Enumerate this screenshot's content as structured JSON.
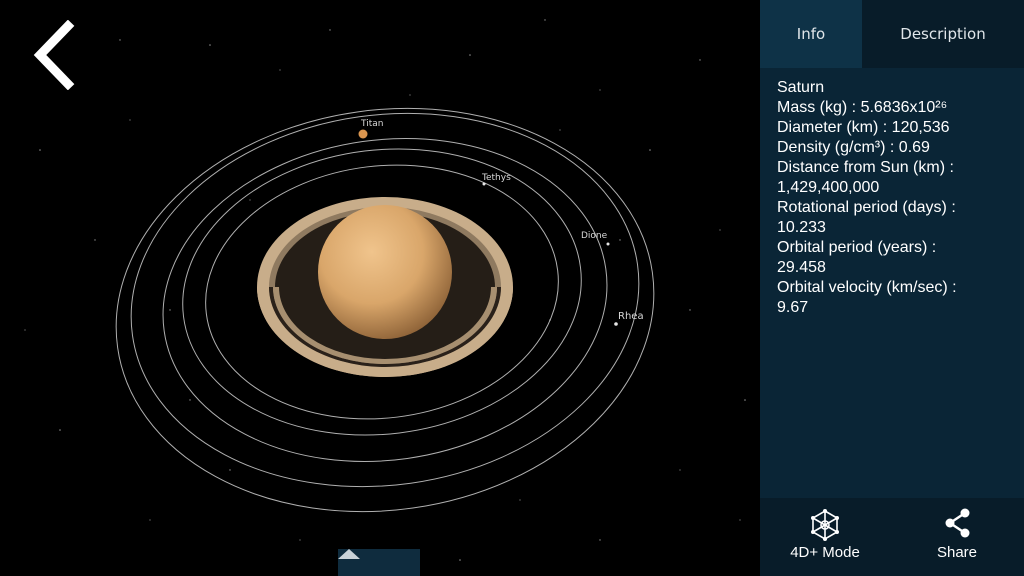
{
  "scene": {
    "moons": [
      {
        "name": "Titan"
      },
      {
        "name": "Tethys"
      },
      {
        "name": "Dione"
      },
      {
        "name": "Rhea"
      }
    ],
    "planet_color": "#d9a66a",
    "ring_color": "#c8ad8a"
  },
  "panel": {
    "tabs": [
      {
        "label": "Info",
        "active": true
      },
      {
        "label": "Description",
        "active": false
      }
    ],
    "info": {
      "name": "Saturn",
      "lines": [
        "Mass (kg) : 5.6836x10²⁶",
        "Diameter (km) : 120,536",
        "Density (g/cm³) : 0.69",
        "Distance from Sun (km) :",
        "1,429,400,000",
        "Rotational period (days) :",
        "10.233",
        "Orbital period (years) :",
        "29.458",
        "Orbital velocity (km/sec) :",
        "9.67"
      ]
    },
    "bottom": {
      "mode_label": "4D+ Mode",
      "share_label": "Share"
    }
  },
  "icons": {
    "back": "chevron-left-icon",
    "expand": "triangle-up-icon",
    "mode": "cube-network-icon",
    "share": "share-icon"
  }
}
